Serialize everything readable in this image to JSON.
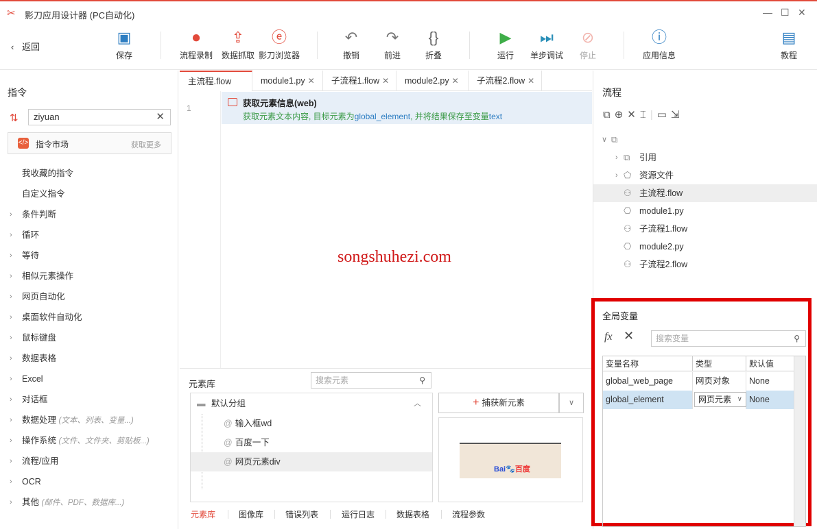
{
  "window": {
    "title": "影刀应用设计器 (PC自动化)",
    "logo_icon": "scissors-logo-icon"
  },
  "toolbar": {
    "back_label": "返回",
    "buttons": [
      {
        "label": "保存",
        "icon": "save-icon"
      },
      {
        "label": "流程录制",
        "icon": "record-icon"
      },
      {
        "label": "数据抓取",
        "icon": "scrape-icon"
      },
      {
        "label": "影刀浏览器",
        "icon": "browser-icon"
      },
      {
        "label": "撤销",
        "icon": "undo-icon"
      },
      {
        "label": "前进",
        "icon": "redo-icon"
      },
      {
        "label": "折叠",
        "icon": "fold-icon"
      },
      {
        "label": "运行",
        "icon": "run-icon"
      },
      {
        "label": "单步调试",
        "icon": "step-debug-icon"
      },
      {
        "label": "停止",
        "icon": "stop-icon"
      },
      {
        "label": "应用信息",
        "icon": "info-icon"
      },
      {
        "label": "教程",
        "icon": "tutorial-icon"
      }
    ]
  },
  "left": {
    "title": "指令",
    "search_value": "ziyuan",
    "market_label": "指令市场",
    "market_more": "获取更多",
    "items": [
      {
        "label": "我收藏的指令",
        "hint": ""
      },
      {
        "label": "自定义指令",
        "hint": ""
      },
      {
        "label": "条件判断",
        "hint": ""
      },
      {
        "label": "循环",
        "hint": ""
      },
      {
        "label": "等待",
        "hint": ""
      },
      {
        "label": "相似元素操作",
        "hint": ""
      },
      {
        "label": "网页自动化",
        "hint": ""
      },
      {
        "label": "桌面软件自动化",
        "hint": ""
      },
      {
        "label": "鼠标键盘",
        "hint": ""
      },
      {
        "label": "数据表格",
        "hint": ""
      },
      {
        "label": "Excel",
        "hint": ""
      },
      {
        "label": "对话框",
        "hint": ""
      },
      {
        "label": "数据处理",
        "hint": "(文本、列表、变量...)"
      },
      {
        "label": "操作系统",
        "hint": "(文件、文件夹、剪贴板...)"
      },
      {
        "label": "流程/应用",
        "hint": ""
      },
      {
        "label": "OCR",
        "hint": ""
      },
      {
        "label": "其他",
        "hint": "(邮件、PDF、数据库...)"
      }
    ]
  },
  "editor": {
    "tabs": [
      "主流程.flow",
      "module1.py",
      "子流程1.flow",
      "module2.py",
      "子流程2.flow"
    ],
    "line_number": "1",
    "step_title": "获取元素信息(web)",
    "step_desc_1": "获取元素文本内容, 目标元素为",
    "step_var_1": "global_element",
    "step_desc_2": ", 并将结果保存至变量",
    "step_var_2": "text",
    "watermark": "songshuhezi.com"
  },
  "element_lib": {
    "title": "元素库",
    "search_placeholder": "搜索元素",
    "group": "默认分组",
    "items": [
      "输入框wd",
      "百度一下",
      "网页元素div"
    ],
    "capture_label": "捕获新元素",
    "preview_logo": "Bai",
    "preview_logo2": "百度",
    "bottom_tabs": [
      "元素库",
      "图像库",
      "错误列表",
      "运行日志",
      "数据表格",
      "流程参数"
    ]
  },
  "right": {
    "title": "流程",
    "tree": [
      {
        "label": "引用",
        "icon": "reference-icon"
      },
      {
        "label": "资源文件",
        "icon": "resource-icon"
      },
      {
        "label": "主流程.flow",
        "icon": "flow-icon"
      },
      {
        "label": "module1.py",
        "icon": "python-icon"
      },
      {
        "label": "子流程1.flow",
        "icon": "flow-icon"
      },
      {
        "label": "module2.py",
        "icon": "python-icon"
      },
      {
        "label": "子流程2.flow",
        "icon": "flow-icon"
      }
    ]
  },
  "globals": {
    "title": "全局变量",
    "fx_label": "fx",
    "search_placeholder": "搜索变量",
    "headers": [
      "变量名称",
      "类型",
      "默认值"
    ],
    "rows": [
      {
        "name": "global_web_page",
        "type": "网页对象",
        "default": "None"
      },
      {
        "name": "global_element",
        "type": "网页元素",
        "default": "None"
      }
    ]
  },
  "colors": {
    "accent": "#e24a3b",
    "highlight": "#e00000",
    "selection": "#cfe3f3"
  }
}
